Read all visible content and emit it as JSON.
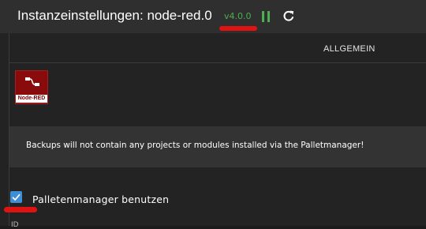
{
  "header": {
    "title": "Instanzeinstellungen: node-red.0",
    "version": "v4.0.0",
    "pause_icon": "pause-icon",
    "refresh_icon": "refresh-icon"
  },
  "tabs": [
    {
      "label": "ALLGEMEIN"
    }
  ],
  "logo": {
    "label": "Node-RED"
  },
  "info": {
    "text": "Backups will not contain any projects or modules installed via the Palletmanager!"
  },
  "options": {
    "palette_manager": {
      "label": "Palletenmanager benutzen",
      "checked": true
    }
  },
  "below_cut": "ID",
  "colors": {
    "accent_green": "#4caf50",
    "checkbox_blue": "#3f8fd6",
    "annotation_red": "#e01313"
  }
}
